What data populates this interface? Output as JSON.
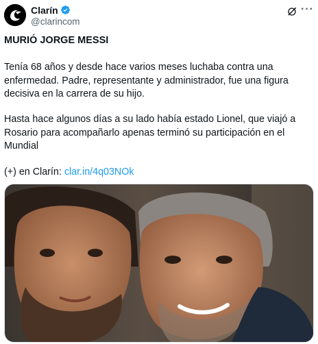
{
  "account": {
    "display_name": "Clarín",
    "handle": "@clarincom"
  },
  "icons": {
    "avatar": "clarin-logo-icon",
    "verified": "verified-badge-icon",
    "grok": "grok-icon",
    "more": "more-options-icon"
  },
  "post": {
    "headline": "MURIÓ JORGE MESSI",
    "paragraph1": "Tenía 68 años y desde hace varios meses luchaba contra una enfermedad. Padre, representante y administrador, fue una figura decisiva en la carrera de su hijo.",
    "paragraph2": "Hasta hace algunos días a su lado había estado Lionel, que viajó a Rosario para acompañarlo apenas terminó su participación en el Mundial",
    "more_prefix": "(+) en Clarín: ",
    "link_text": "clar.in/4q03NOk"
  },
  "colors": {
    "link": "#1d9bf0",
    "verified": "#1d9bf0",
    "text": "#0f1419",
    "secondary": "#536471"
  }
}
